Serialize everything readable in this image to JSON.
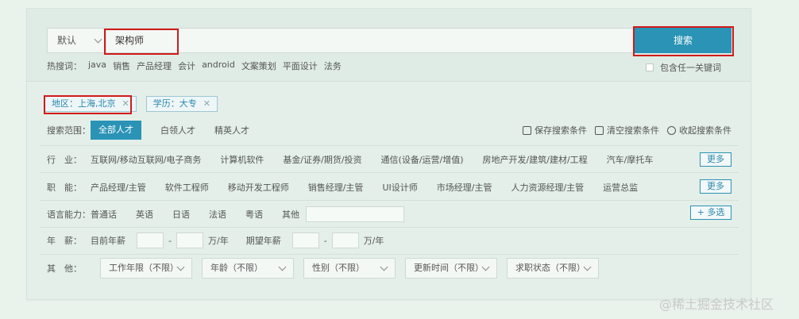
{
  "search": {
    "default_option": "默认",
    "keyword": "架构师",
    "button": "搜索",
    "hot_label": "热搜词：",
    "hot_words": [
      "java",
      "销售",
      "产品经理",
      "会计",
      "android",
      "文案策划",
      "平面设计",
      "法务"
    ],
    "any_keyword_label": "包含任一关键词"
  },
  "filters": {
    "region": "地区：上海,北京",
    "education": "学历：大专"
  },
  "scope": {
    "label": "搜索范围：",
    "options": [
      "全部人才",
      "白领人才",
      "精英人才"
    ],
    "actions": [
      "保存搜索条件",
      "清空搜索条件",
      "收起搜索条件"
    ]
  },
  "industry": {
    "label": "行　业：",
    "items": [
      "互联网/移动互联网/电子商务",
      "计算机软件",
      "基金/证券/期货/投资",
      "通信(设备/运营/增值)",
      "房地产开发/建筑/建材/工程",
      "汽车/摩托车"
    ],
    "more": "更多"
  },
  "position": {
    "label": "职　能：",
    "items": [
      "产品经理/主管",
      "软件工程师",
      "移动开发工程师",
      "销售经理/主管",
      "UI设计师",
      "市场经理/主管",
      "人力资源经理/主管",
      "运营总监"
    ],
    "more": "更多"
  },
  "language": {
    "label": "语言能力：",
    "items": [
      "普通话",
      "英语",
      "日语",
      "法语",
      "粤语",
      "其他"
    ],
    "multi": "+ 多选"
  },
  "salary": {
    "label": "年　薪：",
    "current": "目前年薪",
    "expected": "期望年薪",
    "dash": "-",
    "unit": "万/年"
  },
  "other": {
    "label": "其　他：",
    "dropdowns": [
      "工作年限（不限）",
      "年龄（不限）",
      "性别（不限）",
      "更新时间（不限）",
      "求职状态（不限）"
    ]
  },
  "watermark": "@稀土掘金技术社区",
  "colors": {
    "accent": "#2a93b6",
    "highlight": "#d11a1a"
  }
}
